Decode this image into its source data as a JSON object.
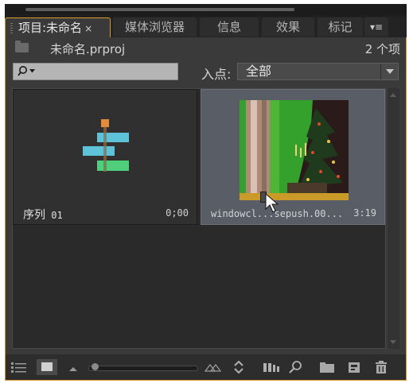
{
  "tabs": [
    {
      "label": "项目:未命名",
      "active": true,
      "close": "×"
    },
    {
      "label": "媒体浏览器",
      "active": false
    },
    {
      "label": "信息",
      "active": false
    },
    {
      "label": "效果",
      "active": false
    },
    {
      "label": "标记",
      "active": false
    }
  ],
  "panel_menu_icon": "▾≡",
  "project": {
    "file_name": "未命名.prproj",
    "item_count": "2 个项"
  },
  "search": {
    "placeholder": "",
    "icon": "search-icon"
  },
  "in_point": {
    "label": "入点:",
    "value": "全部"
  },
  "items": [
    {
      "name_text": "序列",
      "name_num": " 01",
      "duration": "0;00",
      "type": "sequence",
      "selected": false
    },
    {
      "name": "windowcl...sepush.00...",
      "duration": "3:19",
      "type": "video",
      "selected": true
    }
  ],
  "colors": {
    "accent": "#d59a2a",
    "panel_bg": "#3a3a3a",
    "sequence_top": "#e48a3a",
    "sequence_blue": "#5ec3d8",
    "sequence_green": "#4fcf7c",
    "selected_card": "#585d66"
  },
  "toolbar": [
    "list-view-icon",
    "icon-view-icon",
    "zoom-out-icon",
    "zoom-slider",
    "zoom-in-icon",
    "sort-icon",
    "automate-to-sequence-icon",
    "find-icon",
    "new-bin-icon",
    "new-item-icon",
    "delete-icon"
  ]
}
